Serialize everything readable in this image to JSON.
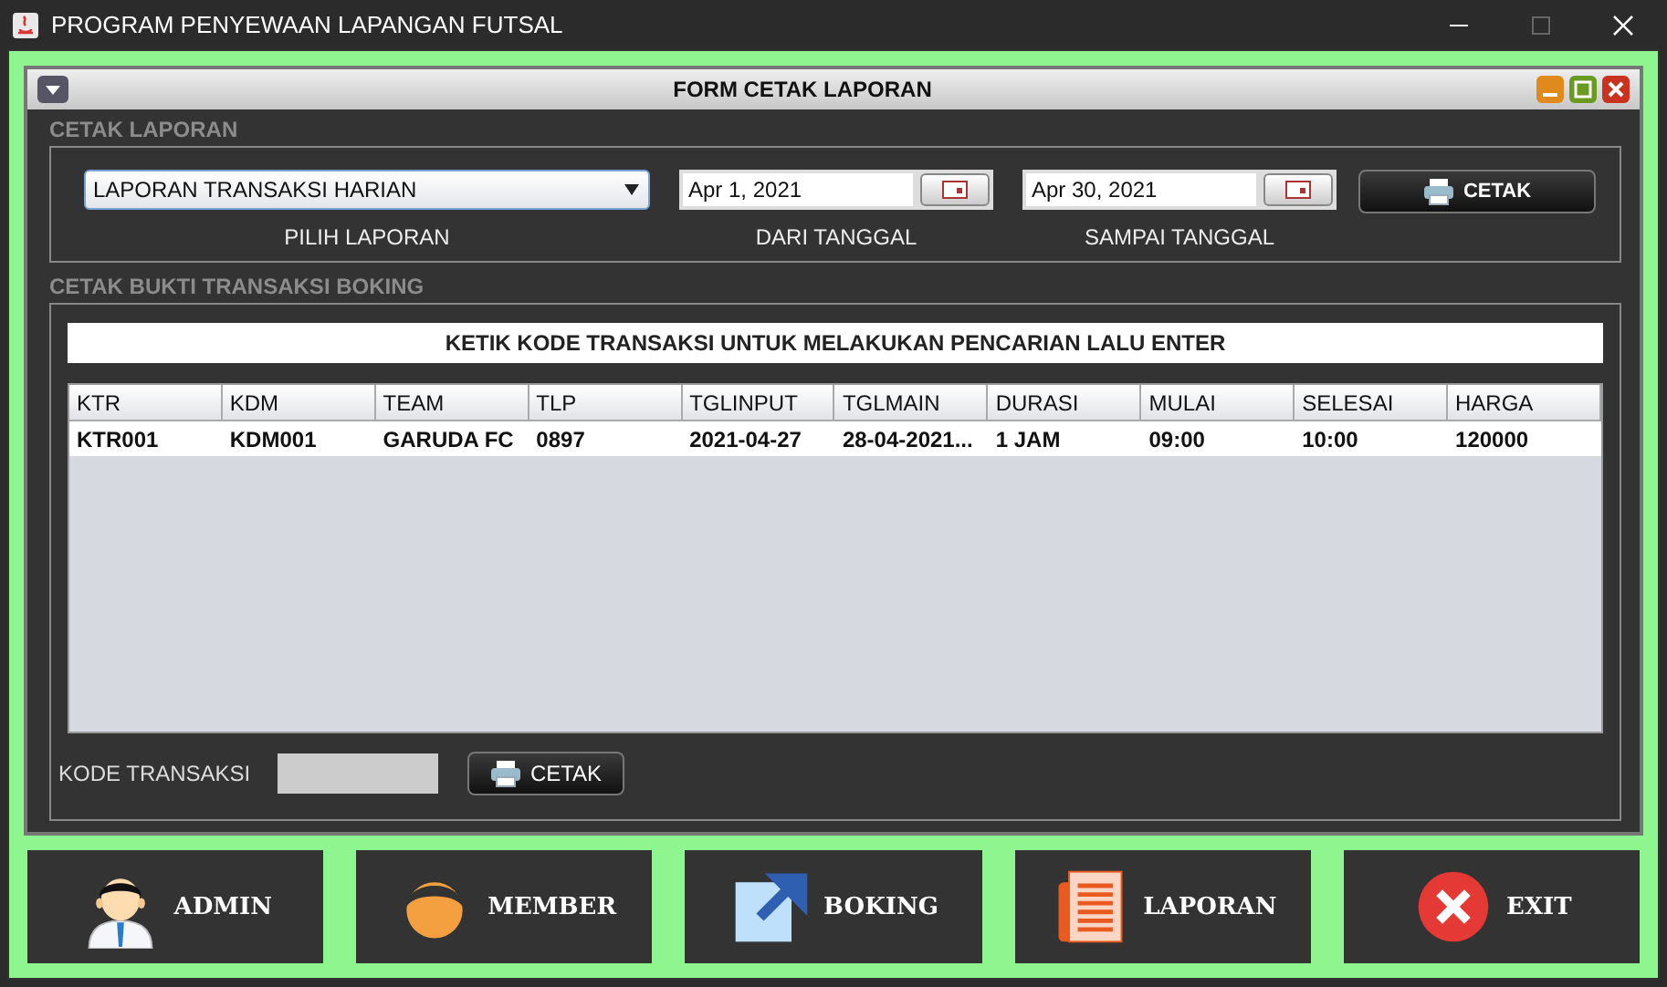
{
  "window": {
    "title": "PROGRAM PENYEWAAN LAPANGAN FUTSAL"
  },
  "form": {
    "title": "FORM CETAK LAPORAN"
  },
  "report_section": {
    "title": "CETAK LAPORAN",
    "report_type": {
      "value": "LAPORAN TRANSAKSI HARIAN",
      "label": "PILIH LAPORAN"
    },
    "from_date": {
      "value": "Apr 1, 2021",
      "label": "DARI TANGGAL"
    },
    "to_date": {
      "value": "Apr 30, 2021",
      "label": "SAMPAI TANGGAL"
    },
    "print_button": "CETAK"
  },
  "booking_section": {
    "title": "CETAK BUKTI TRANSAKSI BOKING",
    "search_hint": "KETIK KODE TRANSAKSI UNTUK MELAKUKAN PENCARIAN LALU ENTER",
    "table": {
      "columns": [
        "KTR",
        "KDM",
        "TEAM",
        "TLP",
        "TGLINPUT",
        "TGLMAIN",
        "DURASI",
        "MULAI",
        "SELESAI",
        "HARGA"
      ],
      "rows": [
        [
          "KTR001",
          "KDM001",
          "GARUDA FC",
          "0897",
          "2021-04-27",
          "28-04-2021...",
          "1 JAM",
          "09:00",
          "10:00",
          "120000"
        ]
      ]
    },
    "code_label": "KODE TRANSAKSI",
    "print_button": "CETAK"
  },
  "nav": [
    {
      "label": "ADMIN",
      "kind": "admin"
    },
    {
      "label": "MEMBER",
      "kind": "member"
    },
    {
      "label": "BOKING",
      "kind": "booking"
    },
    {
      "label": "LAPORAN",
      "kind": "report"
    },
    {
      "label": "EXIT",
      "kind": "exit"
    }
  ]
}
